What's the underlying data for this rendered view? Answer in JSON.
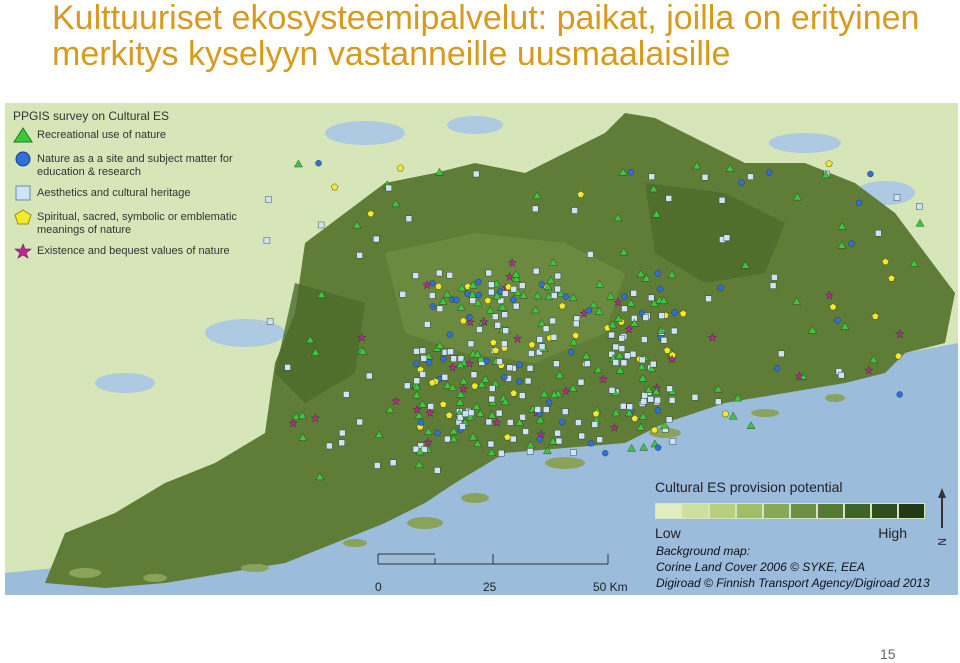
{
  "title": "Kulttuuriset ekosysteemipalvelut: paikat, joilla on erityinen merkitys kyselyyn vastanneille uusmaalaisille",
  "legend": {
    "title": "PPGIS survey on Cultural ES",
    "items": [
      {
        "label": "Recreational use of nature",
        "symbol": "triangle",
        "color": "#3cc83c"
      },
      {
        "label": "Nature as a a site and subject matter for education & research",
        "symbol": "circle",
        "color": "#2f6fd8"
      },
      {
        "label": "Aesthetics and cultural heritage",
        "symbol": "square",
        "color": "#cde4f6"
      },
      {
        "label": "Spiritual, sacred, symbolic or emblematic meanings of nature",
        "symbol": "pentagon",
        "color": "#f2ea2a"
      },
      {
        "label": "Existence and bequest values of nature",
        "symbol": "star",
        "color": "#c0259c"
      }
    ]
  },
  "scale": {
    "ticks": [
      "0",
      "25",
      "50 Km"
    ]
  },
  "ramp": {
    "title": "Cultural ES provision potential",
    "low": "Low",
    "high": "High",
    "colors": [
      "#e3eec0",
      "#cfe09c",
      "#b8d07e",
      "#9fbf66",
      "#85a955",
      "#6b9244",
      "#537a34",
      "#3f6428",
      "#2e4e1e",
      "#1f3a14"
    ]
  },
  "credit": {
    "line1": "Background map:",
    "line2": "Corine Land Cover 2006 © SYKE, EEA",
    "line3": "Digiroad © Finnish Transport Agency/Digiroad 2013"
  },
  "north_label": "N",
  "page_number": "15",
  "colors": {
    "title": "#d79a1c",
    "sea": "#9cbcdc",
    "land_outside": "#d6e6b8",
    "land_region": "#5f7d36"
  }
}
